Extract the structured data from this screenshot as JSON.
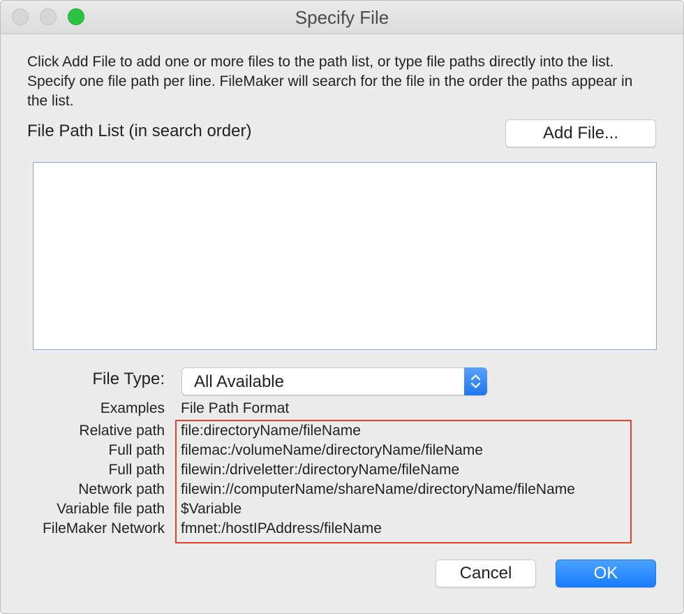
{
  "window": {
    "title": "Specify File"
  },
  "description": "Click Add File to add one or more files to the path list, or type file paths directly into the list. Specify one file path per line. FileMaker will search for the file in the order the paths appear in the list.",
  "path_list": {
    "label": "File Path List (in search order)",
    "add_button_label": "Add File...",
    "value": ""
  },
  "file_type": {
    "label": "File Type:",
    "selected": "All Available"
  },
  "examples": {
    "header_left": "Examples",
    "header_right": "File Path Format",
    "rows": [
      {
        "label": "Relative path",
        "format": "file:directoryName/fileName"
      },
      {
        "label": "Full path",
        "format": "filemac:/volumeName/directoryName/fileName"
      },
      {
        "label": "Full path",
        "format": "filewin:/driveletter:/directoryName/fileName"
      },
      {
        "label": "Network path",
        "format": "filewin://computerName/shareName/directoryName/fileName"
      },
      {
        "label": "Variable file path",
        "format": "$Variable"
      },
      {
        "label": "FileMaker Network",
        "format": "fmnet:/hostIPAddress/fileName"
      }
    ]
  },
  "buttons": {
    "cancel": "Cancel",
    "ok": "OK"
  },
  "colors": {
    "accent": "#1a7dff",
    "highlight": "#e8422c",
    "zoom_light": "#29c440"
  },
  "icons": {
    "stepper": "up-down-chevron-icon"
  }
}
